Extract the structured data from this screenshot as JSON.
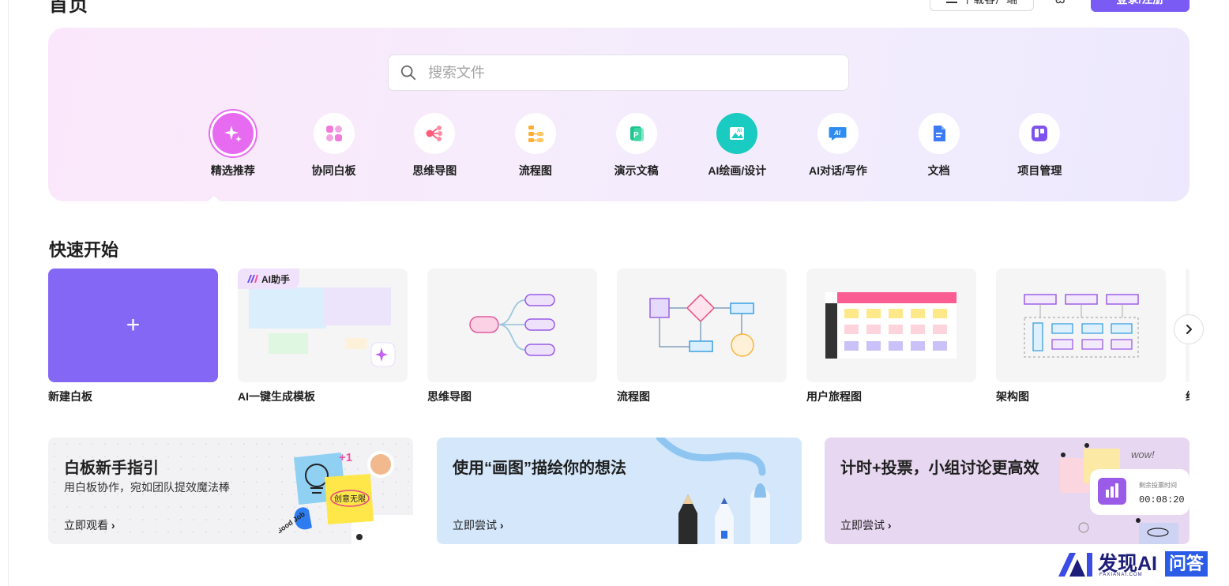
{
  "header": {
    "page_title": "首页",
    "download_label": "下载客户端",
    "lang_icon": "language-icon",
    "login_label": "登录/注册"
  },
  "search": {
    "placeholder": "搜索文件"
  },
  "categories": [
    {
      "label": "精选推荐",
      "icon": "sparkle-icon",
      "active": true
    },
    {
      "label": "协同白板",
      "icon": "whiteboard-icon"
    },
    {
      "label": "思维导图",
      "icon": "mindmap-icon"
    },
    {
      "label": "流程图",
      "icon": "flowchart-icon"
    },
    {
      "label": "演示文稿",
      "icon": "presentation-icon"
    },
    {
      "label": "AI绘画/设计",
      "icon": "ai-painting-icon"
    },
    {
      "label": "AI对话/写作",
      "icon": "ai-chat-icon"
    },
    {
      "label": "文档",
      "icon": "document-icon"
    },
    {
      "label": "项目管理",
      "icon": "project-icon"
    }
  ],
  "quick_start": {
    "title": "快速开始",
    "ai_badge": "AI助手",
    "items": [
      {
        "label": "新建白板"
      },
      {
        "label": "AI一键生成模板"
      },
      {
        "label": "思维导图"
      },
      {
        "label": "流程图"
      },
      {
        "label": "用户旅程图"
      },
      {
        "label": "架构图"
      },
      {
        "label": "线框图"
      }
    ]
  },
  "banners": [
    {
      "title": "白板新手指引",
      "subtitle": "用白板协作，宛如团队提效魔法棒",
      "link": "立即观看",
      "art_text": [
        "创意无限",
        "+1",
        "Good Job"
      ]
    },
    {
      "title": "使用“画图”描绘你的想法",
      "link": "立即尝试"
    },
    {
      "title": "计时+投票，小组讨论更高效",
      "link": "立即尝试",
      "art_text": [
        "剩余投票时间",
        "00:08:20",
        "wow!"
      ]
    }
  ],
  "watermark": {
    "brand": "发现AI",
    "domain": "FAXIANAI.COM",
    "qa": "问答"
  },
  "colors": {
    "accent": "#7a5cf4",
    "active": "#e66bf0",
    "teal": "#19cbc0"
  }
}
